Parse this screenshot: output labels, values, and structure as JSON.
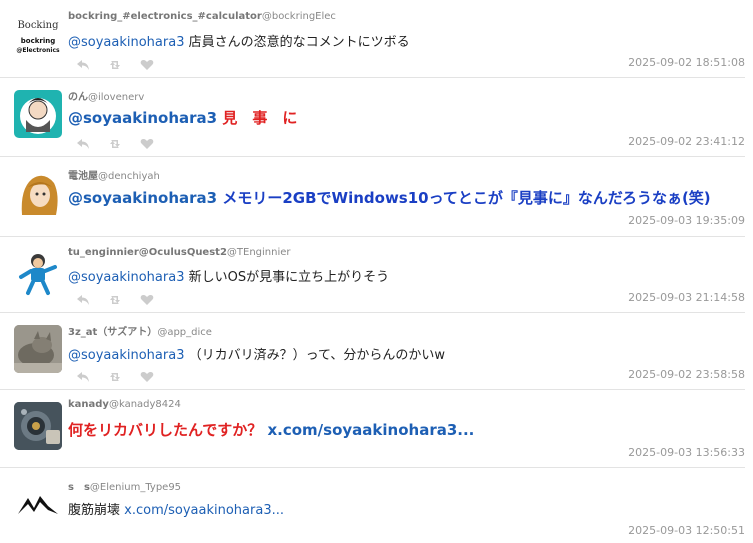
{
  "tweets": [
    {
      "display_name": "bockring_#electronics_#calculator",
      "screen_name": "@bockringElec",
      "mention": "@soyaakinohara3",
      "text": " 店員さんの恣意的なコメントにツボる",
      "timestamp": "2025-09-02 18:51:08",
      "avatar_text": [
        "Bocking",
        "bockring",
        "@Electronics"
      ]
    },
    {
      "display_name": "のん",
      "screen_name": "@ilovenerv",
      "mention": "@soyaakinohara3",
      "text": " 見　事　に",
      "timestamp": "2025-09-02 23:41:12"
    },
    {
      "display_name": "電池屋",
      "screen_name": "@denchiyah",
      "mention": "@soyaakinohara3",
      "text": " メモリー2GBでWindows10ってとこが『見事に』なんだろうなぁ(笑)",
      "timestamp": "2025-09-03 19:35:09"
    },
    {
      "display_name": "tu_enginnier@OculusQuest2",
      "screen_name": "@TEnginnier",
      "mention": "@soyaakinohara3",
      "text": " 新しいOSが見事に立ち上がりそう",
      "timestamp": "2025-09-03 21:14:58"
    },
    {
      "display_name": "3z_at（サズアト）",
      "screen_name": "@app_dice",
      "mention": "@soyaakinohara3",
      "text": " （リカバリ済み？）って、分からんのかいw",
      "timestamp": "2025-09-02 23:58:58"
    },
    {
      "display_name": "kanady",
      "screen_name": "@kanady8424",
      "text": "何をリカバリしたんですか？ ",
      "link": "x.com/soyaakinohara3...",
      "timestamp": "2025-09-03 13:56:33"
    },
    {
      "display_name": "s　s",
      "screen_name": "@Elenium_Type95",
      "text": "腹筋崩壊 ",
      "link": "x.com/soyaakinohara3...",
      "timestamp": "2025-09-03 12:50:51"
    }
  ],
  "icons": [
    "reply-icon",
    "retweet-icon",
    "like-icon"
  ],
  "colors": {
    "mention": "#1d5fb4",
    "red_text": "#e02222",
    "blue_text": "#1a3fc4",
    "meta": "#999999"
  }
}
